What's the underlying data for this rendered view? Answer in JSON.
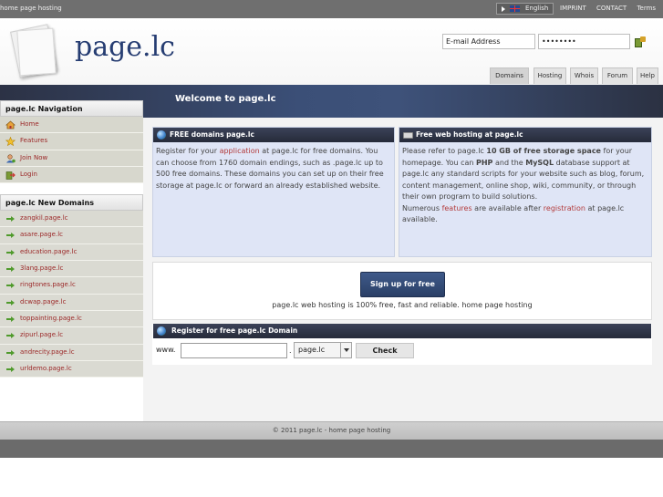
{
  "topbar": {
    "tagline": "home page hosting",
    "language": "English",
    "links": [
      "IMPRINT",
      "CONTACT",
      "Terms"
    ]
  },
  "header": {
    "logo_text": "page.lc",
    "email_placeholder": "E-mail Address",
    "password_value": "••••••••",
    "tabs": [
      "Domains",
      "Hosting",
      "Whois",
      "Forum",
      "Help"
    ]
  },
  "banner": {
    "title": "Welcome to page.lc"
  },
  "sidebar": {
    "nav_title": "page.lc Navigation",
    "nav_items": [
      {
        "label": "Home",
        "icon": "home-icon"
      },
      {
        "label": "Features",
        "icon": "star-icon"
      },
      {
        "label": "Join Now",
        "icon": "user-add-icon"
      },
      {
        "label": "Login",
        "icon": "login-icon"
      }
    ],
    "domains_title": "page.lc New Domains",
    "domains": [
      "zangkil.page.lc",
      "asare.page.lc",
      "education.page.lc",
      "3lang.page.lc",
      "ringtones.page.lc",
      "dcwap.page.lc",
      "toppainting.page.lc",
      "zipurl.page.lc",
      "andrecity.page.lc",
      "urldemo.page.lc"
    ]
  },
  "free_domains": {
    "title": "FREE domains page.lc",
    "text_1": "Register for your ",
    "link_1": "application",
    "text_2": " at page.lc for free domains. You can choose from 1760 domain endings, such as .page.lc up to 500 free domains. These domains you can set up on their free storage at page.lc or forward an already established website."
  },
  "web_hosting": {
    "title": "Free web hosting at page.lc",
    "t1": "Please refer to page.lc ",
    "b1": "10 GB of free storage space",
    "t2": " for your homepage. You can ",
    "b2": "PHP",
    "t3": " and the ",
    "b3": "MySQL",
    "t4": " database support at page.lc any standard scripts for your website such as blog, forum, content management, online shop, wiki, community, or through their own program to build solutions.",
    "t5": "Numerous ",
    "l1": "features",
    "t6": " are available after ",
    "l2": "registration",
    "t7": " at page.lc available."
  },
  "signup": {
    "button": "Sign up for free",
    "note": "page.lc web hosting is 100% free, fast and reliable. home page hosting"
  },
  "register": {
    "title": "Register for free page.lc Domain",
    "prefix": "www.",
    "dot": ".",
    "tld": "page.lc",
    "check": "Check"
  },
  "footer": {
    "text": "© 2011 page.lc - home page hosting"
  },
  "colors": {
    "accent": "#263d72",
    "link": "#b33c3c",
    "sidebar_link": "#9b2727"
  }
}
